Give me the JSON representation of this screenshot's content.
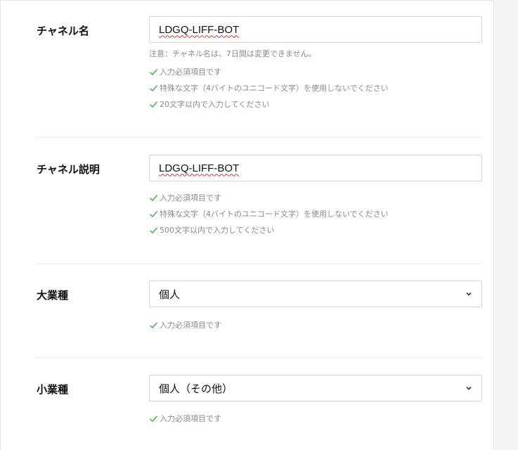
{
  "fields": {
    "channel_name": {
      "label": "チャネル名",
      "value_typed": "LDGQ-LIFF-BOT",
      "note": "注意：チャネル名は、7日間は変更できません。",
      "rules": [
        "入力必須項目です",
        "特殊な文字（4バイトのユニコード文字）を使用しないでください",
        "20文字以内で入力してください"
      ]
    },
    "channel_description": {
      "label": "チャネル説明",
      "value_typed": "LDGQ-LIFF-BOT",
      "rules": [
        "入力必須項目です",
        "特殊な文字（4バイトのユニコード文字）を使用しないでください",
        "500文字以内で入力してください"
      ]
    },
    "major_industry": {
      "label": "大業種",
      "selected": "個人",
      "rules": [
        "入力必須項目です"
      ]
    },
    "minor_industry": {
      "label": "小業種",
      "selected": "個人（その他）",
      "rules": [
        "入力必須項目です"
      ]
    }
  },
  "icons": {
    "check": "check-icon",
    "chevron": "chevron-down-icon"
  },
  "colors": {
    "check_green": "#4cb24c",
    "hint_gray": "#8a8a8a",
    "spellcheck_red": "#e0312f"
  }
}
